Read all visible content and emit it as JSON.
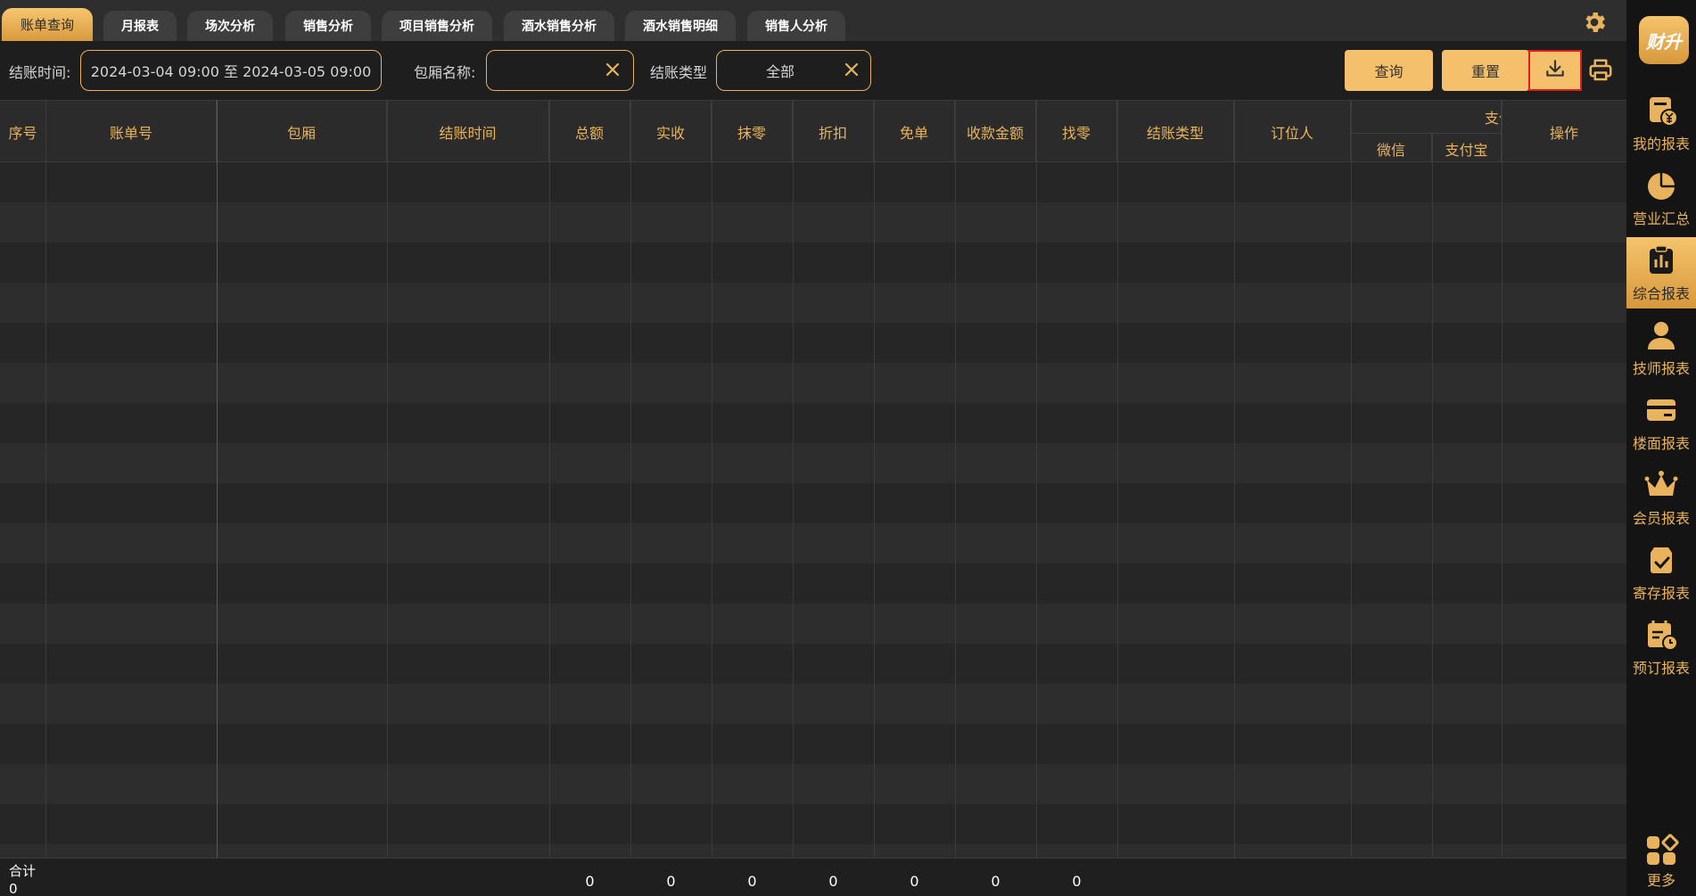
{
  "tabs": [
    {
      "label": "账单查询",
      "active": true
    },
    {
      "label": "月报表"
    },
    {
      "label": "场次分析"
    },
    {
      "label": "销售分析"
    },
    {
      "label": "项目销售分析"
    },
    {
      "label": "酒水销售分析"
    },
    {
      "label": "酒水销售明细"
    },
    {
      "label": "销售人分析"
    }
  ],
  "filters": {
    "time_label": "结账时间:",
    "time_value": "2024-03-04 09:00 至 2024-03-05 09:00",
    "room_label": "包厢名称:",
    "room_value": "",
    "type_label": "结账类型",
    "type_value": "全部"
  },
  "buttons": {
    "query": "查询",
    "reset": "重置"
  },
  "table": {
    "headers": {
      "index": "序号",
      "bill_no": "账单号",
      "room": "包厢",
      "checkout_time": "结账时间",
      "total": "总额",
      "received": "实收",
      "rounding": "抹零",
      "discount": "折扣",
      "free": "免单",
      "collected": "收款金额",
      "change": "找零",
      "checkout_type": "结账类型",
      "booker": "订位人",
      "payment_group": "支付",
      "wechat": "微信",
      "alipay": "支付宝",
      "actions": "操作"
    },
    "footer": {
      "label": "合计",
      "count": "0",
      "total": "0",
      "received": "0",
      "rounding": "0",
      "discount": "0",
      "free": "0",
      "collected": "0",
      "change": "0"
    }
  },
  "sidebar": {
    "logo": "财升",
    "items": [
      {
        "label": "我的报表"
      },
      {
        "label": "营业汇总"
      },
      {
        "label": "综合报表",
        "active": true
      },
      {
        "label": "技师报表"
      },
      {
        "label": "楼面报表"
      },
      {
        "label": "会员报表"
      },
      {
        "label": "寄存报表"
      },
      {
        "label": "预订报表"
      }
    ],
    "more": "更多"
  },
  "colors": {
    "accent": "#e8b35c",
    "button": "#f5c06c",
    "highlight_border": "#e01b1b"
  }
}
